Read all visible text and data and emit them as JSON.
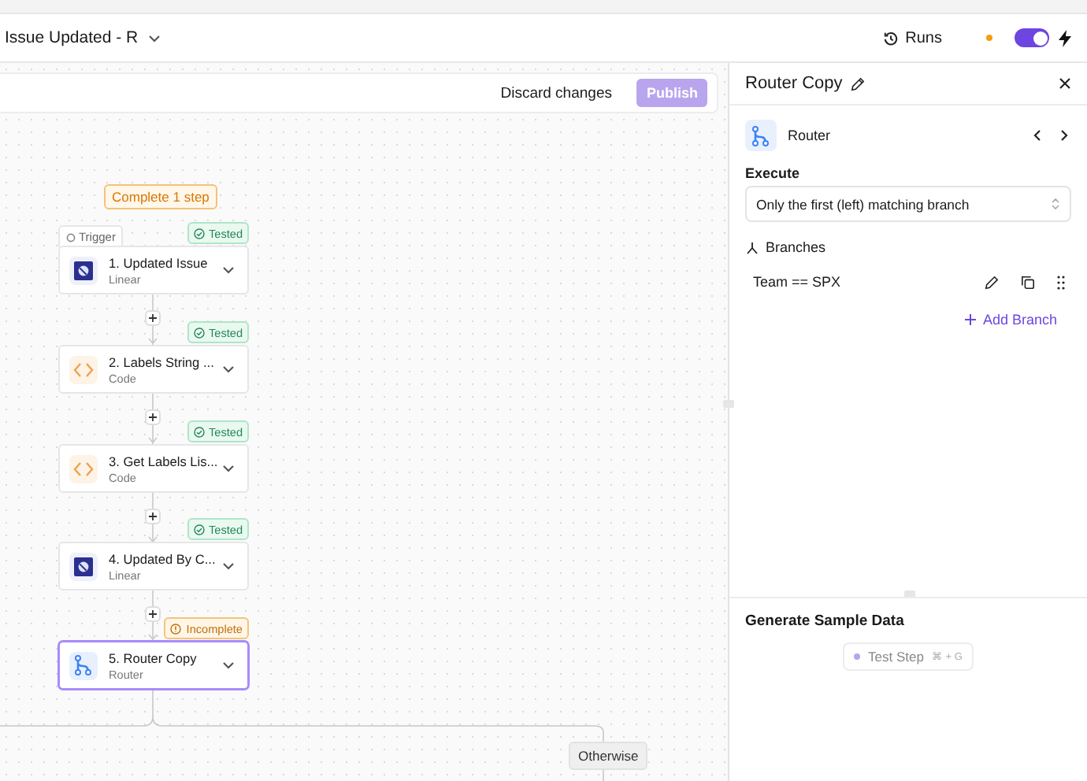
{
  "header": {
    "title": "Issue Updated - R",
    "runs_label": "Runs",
    "unsaved": true,
    "enabled": true
  },
  "toolbar": {
    "discard": "Discard changes",
    "publish": "Publish",
    "publish_disabled": true
  },
  "canvas": {
    "summary": "Complete 1 step",
    "trigger_tab": "Trigger",
    "steps": [
      {
        "title": "1. Updated Issue",
        "app": "Linear",
        "kind": "linear",
        "status": "Tested",
        "warning": false,
        "selected": false
      },
      {
        "title": "2. Labels String ...",
        "app": "Code",
        "kind": "code",
        "status": "Tested",
        "warning": false,
        "selected": false
      },
      {
        "title": "3. Get Labels Lis...",
        "app": "Code",
        "kind": "code",
        "status": "Tested",
        "warning": false,
        "selected": false
      },
      {
        "title": "4. Updated By C...",
        "app": "Linear",
        "kind": "linear",
        "status": "Tested",
        "warning": false,
        "selected": false
      },
      {
        "title": "5. Router Copy",
        "app": "Router",
        "kind": "router",
        "status": "Incomplete",
        "warning": true,
        "selected": true
      }
    ],
    "otherwise": "Otherwise"
  },
  "panel": {
    "title": "Router Copy",
    "piece": "Router",
    "execute_label": "Execute",
    "execute_value": "Only the first (left) matching branch",
    "branches_label": "Branches",
    "branches": [
      {
        "condition": "Team == SPX"
      }
    ],
    "add_branch": "Add Branch",
    "sample_title": "Generate Sample Data",
    "test_step": "Test Step",
    "shortcut": "⌘ + G"
  }
}
